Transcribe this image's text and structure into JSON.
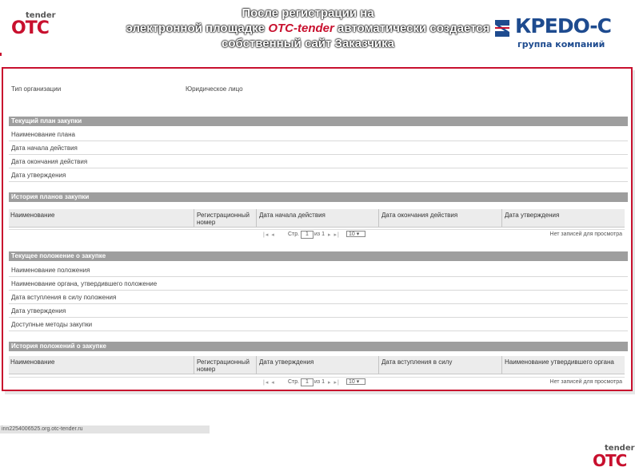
{
  "logo": {
    "top": "tender",
    "main": "OTC"
  },
  "slide_title": {
    "line1": "После регистрации на",
    "line2_pre": "электронной площадке ",
    "line2_hl": "OTC-tender",
    "line2_post": " автоматически создается",
    "line3": "собственный сайт Заказчика"
  },
  "partner_logo": {
    "name": "КРЕDO-С",
    "subtitle": "группа компаний"
  },
  "info_row": {
    "label1": "Тип организации",
    "label2": "Юридическое лицо"
  },
  "section_plan": {
    "title": "Текущий план закупки",
    "fields": [
      "Наименование плана",
      "Дата начала действия",
      "Дата окончания действия",
      "Дата утверждения"
    ]
  },
  "section_plan_history": {
    "title": "История планов закупки",
    "columns": [
      "Наименование",
      "Регистрационный номер",
      "Дата начала действия",
      "Дата окончания действия",
      "Дата утверждения"
    ]
  },
  "pager": {
    "page_label": "Стр.",
    "page_value": "1",
    "of_label": "из 1",
    "page_size": "10",
    "no_records": "Нет записей для просмотра"
  },
  "section_regulation": {
    "title": "Текущее положение о закупке",
    "fields": [
      "Наименование положения",
      "Наименование органа, утвердившего положение",
      "Дата вступления в силу положения",
      "Дата утверждения",
      "Доступные методы закупки"
    ]
  },
  "section_regulation_history": {
    "title": "История положений о закупке",
    "columns": [
      "Наименование",
      "Регистрационный номер",
      "Дата утверждения",
      "Дата вступления в силу",
      "Наименование утвердившего органа"
    ]
  },
  "status_bar": {
    "url": "inn2254006525.org.otc-tender.ru"
  },
  "colors": {
    "brand_red": "#c8102e",
    "kredo_blue": "#1e4b8f",
    "section_gray": "#9e9e9e"
  }
}
